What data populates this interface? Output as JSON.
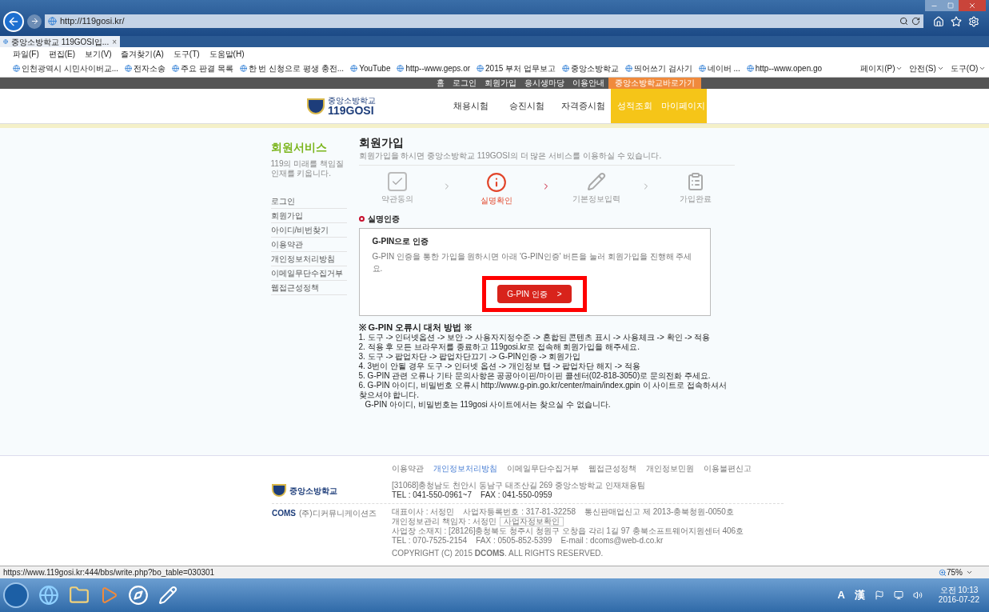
{
  "browser": {
    "address": "http://119gosi.kr/",
    "tab": {
      "title": "중앙소방학교 119GOSI입...",
      "close": "×"
    },
    "menu": [
      "파일(F)",
      "편집(E)",
      "보기(V)",
      "즐겨찾기(A)",
      "도구(T)",
      "도움말(H)"
    ],
    "favorites": [
      "인천광역시 시민사이버교...",
      "전자소송",
      "주요 판결 목록",
      "한 번 신청으로 평생 충전...",
      "YouTube",
      "http--www.geps.or",
      "2015 부처 업무보고",
      "중앙소방학교",
      "띄어쓰기 검사기",
      "네이버 ...",
      "http--www.open.go"
    ],
    "commands": [
      "페이지(P)",
      "안전(S)",
      "도구(O)"
    ]
  },
  "site": {
    "top_links": [
      {
        "label": "홈",
        "highlighted": false
      },
      {
        "label": "로그인",
        "highlighted": false
      },
      {
        "label": "회원가입",
        "highlighted": false
      },
      {
        "label": "응시생마당",
        "highlighted": false
      },
      {
        "label": "이용안내",
        "highlighted": false
      },
      {
        "label": "중앙소방학교바로가기",
        "highlighted": true
      }
    ],
    "logo": {
      "name": "중앙소방학교",
      "brand": "119GOSI"
    },
    "nav": [
      {
        "label": "채용시험",
        "highlighted": false
      },
      {
        "label": "승진시험",
        "highlighted": false
      },
      {
        "label": "자격증시험",
        "highlighted": false
      },
      {
        "label": "성적조회",
        "highlighted": true
      },
      {
        "label": "마이페이지",
        "highlighted": true
      }
    ]
  },
  "sidebar": {
    "title": "회원서비스",
    "subtitle": "119의 미래를 책임질 인재를 키웁니다.",
    "items": [
      "로그인",
      "회원가입",
      "아이디/비번찾기",
      "이용약관",
      "개인정보처리방침",
      "이메일무단수집거부",
      "웹접근성정책"
    ]
  },
  "main": {
    "title": "회원가입",
    "subtitle": "회원가입을 하시면 중앙소방학교 119GOSI의 더 많은 서비스를 이용하실 수 있습니다.",
    "steps": [
      {
        "kind": "check",
        "label": "약관동의",
        "selected": false
      },
      {
        "kind": "info",
        "label": "실명확인",
        "selected": true
      },
      {
        "kind": "pencil",
        "label": "기본정보입력",
        "selected": false
      },
      {
        "kind": "card",
        "label": "가입완료",
        "selected": false
      }
    ],
    "section": "실명인증",
    "gpin": {
      "title": "G-PIN으로 인증",
      "description": "G-PIN 인증을 통한 가입을 원하시면 아래 'G-PIN인증' 버튼을 눌러 회원가입을 진행해 주세요.",
      "button": "G-PIN 인증",
      "button_arrow": ">",
      "highlighted": true
    },
    "notes": {
      "title": "※ G-PIN 오류시 대처 방법 ※",
      "lines": [
        "1. 도구 -> 인터넷옵션 -> 보안 -> 사용자지정수준 -> 혼합된 콘텐츠 표시 -> 사용체크 -> 확인 -> 적용",
        "2. 적용 후 모든 브라우저를 종료하고 119gosi.kr로 접속해 회원가입을 해주세요.",
        "3. 도구 -> 팝업차단 -> 팝업차단끄기 -> G-PIN인증 -> 회원가입",
        "4. 3번이 안될 경우 도구 -> 인터넷 옵션 -> 개인정보 탭 -> 팝업차단 해지 -> 적용",
        "5. G-PIN 관련 오류나 기타 문의사항은 공공아이핀/마이핀 콜센터(02-818-3050)로 문의전화 주세요.",
        "6. G-PIN 아이디, 비밀번호 오류시 http://www.g-pin.go.kr/center/main/index.gpin 이 사이트로 접속하셔서 찾으셔야 합니다.",
        "G-PIN 아이디, 비밀번호는 119gosi 사이트에서는 찾으실 수 없습니다."
      ]
    }
  },
  "footer": {
    "links": [
      {
        "label": "이용약관",
        "highlighted": false
      },
      {
        "label": "개인정보처리방침",
        "highlighted": true
      },
      {
        "label": "이메일무단수집거부",
        "highlighted": false
      },
      {
        "label": "웹접근성정책",
        "highlighted": false
      },
      {
        "label": "개인정보민원",
        "highlighted": false
      },
      {
        "label": "이용불편신고",
        "highlighted": false
      }
    ],
    "school": {
      "name": "중앙소방학교",
      "address": "[31068]충청남도 천안시 동남구 태조산길 269 중앙소방학교 인재채용팀",
      "contact": "TEL : 041-550-0961~7    FAX : 041-550-0959"
    },
    "company": {
      "logo": "COMS",
      "name": "(주)디커뮤니케이션즈",
      "lines": [
        "대표이사 : 서정민    사업자등록번호 : 317-81-32258    통신판매업신고 제 2013-충북청원-0050호",
        "개인정보관리 책임자 : 서정민",
        "사업장 소재지 : [28126]충청북도 청주시 청원구 오창읍 각리 1길 97 충북소프트웨어지원센터 406호",
        "TEL : 070-7525-2154    FAX : 0505-852-5399    E-mail : dcoms@web-d.co.kr"
      ],
      "info_button": "사업자정보확인"
    },
    "copyright": "COPYRIGHT (C) 2015 **DCOMS**. ALL RIGHTS RESERVED."
  },
  "status_bar": {
    "url": "https://www.119gosi.kr:444/bbs/write.php?bo_table=030301",
    "zoom": "75%"
  },
  "taskbar": {
    "tray": [
      "A",
      "漢"
    ],
    "time": "오전 10:13",
    "date": "2016-07-22"
  }
}
